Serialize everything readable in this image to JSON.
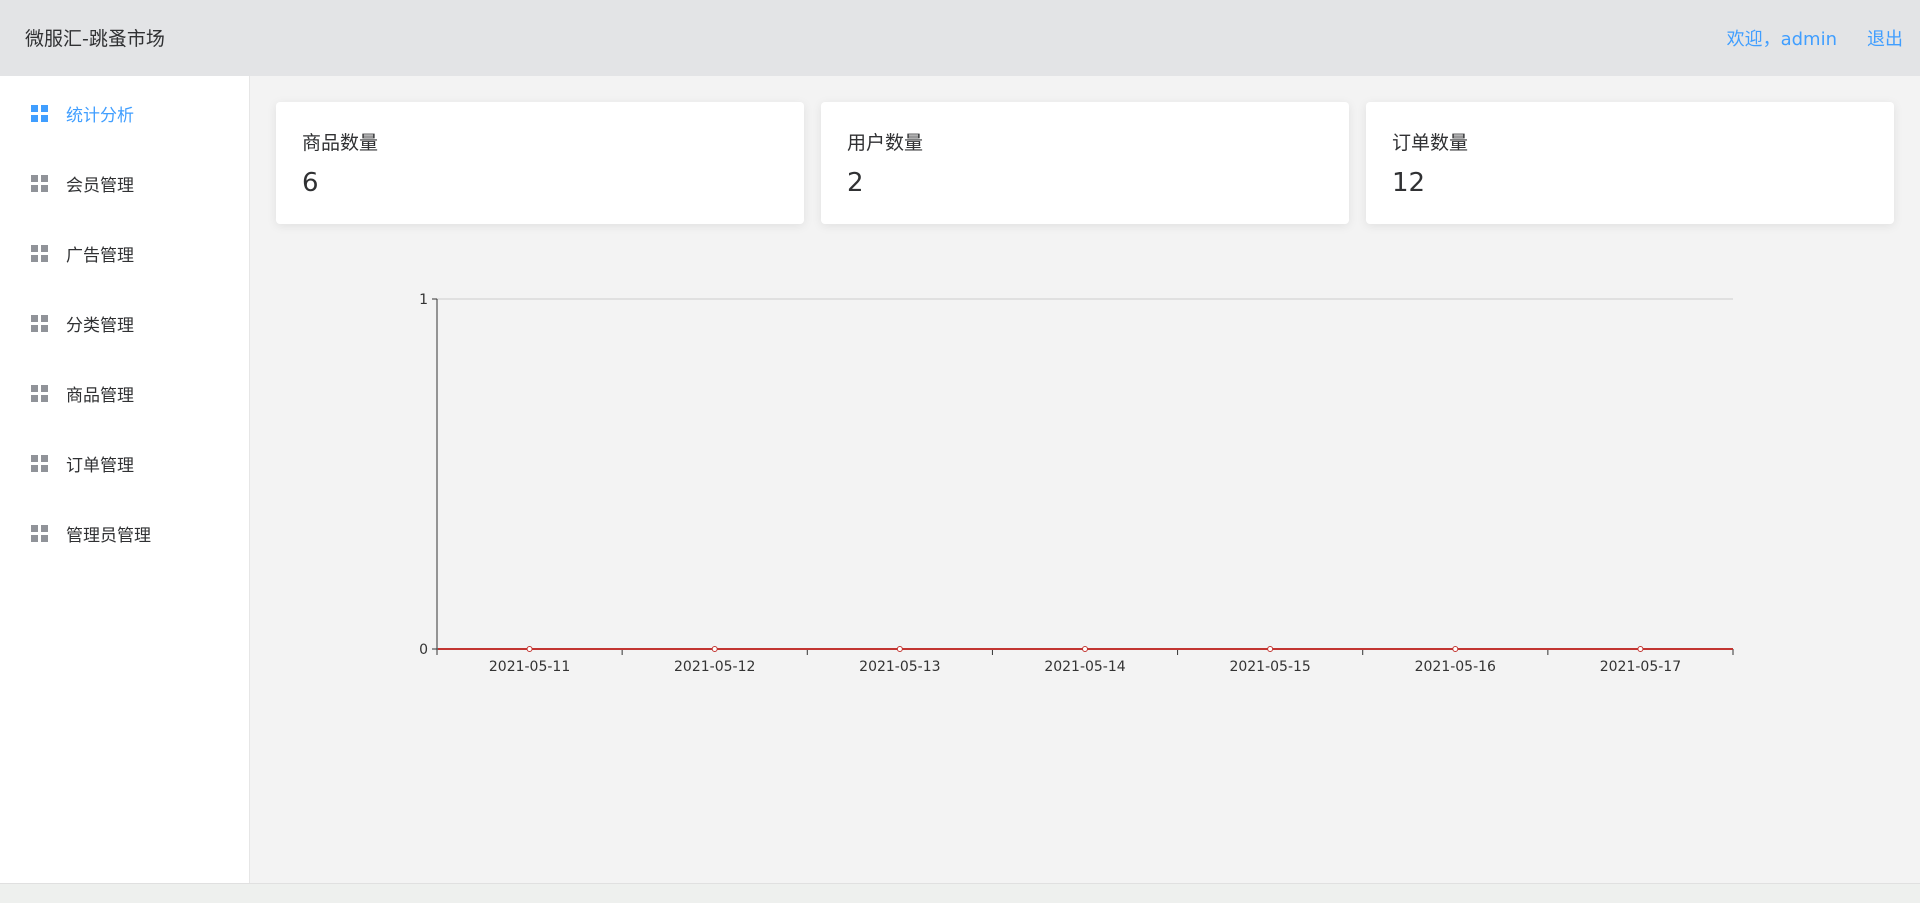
{
  "header": {
    "title": "微服汇-跳蚤市场",
    "welcome": "欢迎，admin",
    "logout": "退出"
  },
  "sidebar": {
    "items": [
      {
        "label": "统计分析",
        "icon": "grid-icon",
        "active": true
      },
      {
        "label": "会员管理",
        "icon": "grid-icon",
        "active": false
      },
      {
        "label": "广告管理",
        "icon": "grid-icon",
        "active": false
      },
      {
        "label": "分类管理",
        "icon": "grid-icon",
        "active": false
      },
      {
        "label": "商品管理",
        "icon": "grid-icon",
        "active": false
      },
      {
        "label": "订单管理",
        "icon": "grid-icon",
        "active": false
      },
      {
        "label": "管理员管理",
        "icon": "grid-icon",
        "active": false
      }
    ]
  },
  "stats": [
    {
      "label": "商品数量",
      "value": "6"
    },
    {
      "label": "用户数量",
      "value": "2"
    },
    {
      "label": "订单数量",
      "value": "12"
    }
  ],
  "colors": {
    "accent": "#409eff",
    "series": "#c23531",
    "header_bg": "#e3e4e6",
    "main_bg": "#f3f3f3"
  },
  "chart_data": {
    "type": "line",
    "categories": [
      "2021-05-11",
      "2021-05-12",
      "2021-05-13",
      "2021-05-14",
      "2021-05-15",
      "2021-05-16",
      "2021-05-17"
    ],
    "series": [
      {
        "values": [
          0,
          0,
          0,
          0,
          0,
          0,
          0
        ]
      }
    ],
    "yticks": [
      "0",
      "1"
    ],
    "ylim": [
      0,
      1
    ],
    "grid": true
  }
}
